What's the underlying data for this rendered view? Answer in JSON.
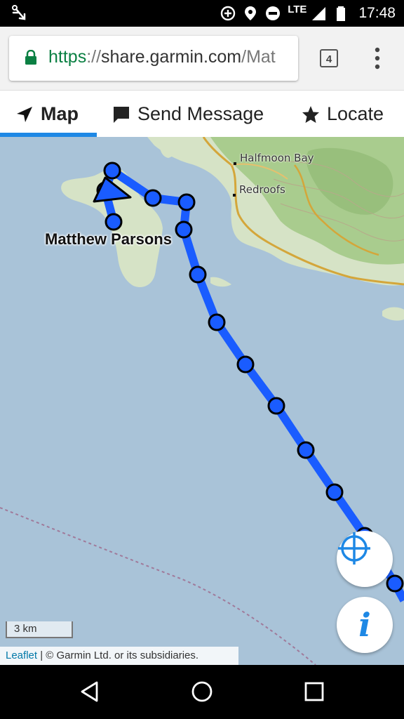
{
  "status_bar": {
    "left_icon": "anchor-icon",
    "icons": [
      "data-saver-icon",
      "location-pin-icon",
      "do-not-disturb-icon",
      "signal-icon",
      "battery-icon"
    ],
    "network": "LTE",
    "time": "17:48"
  },
  "browser": {
    "url_scheme": "https",
    "url_sep": "://",
    "url_host": "share.garmin.com",
    "url_path": "/Mat",
    "tab_count": "4",
    "menu_icon": "more-vert-icon"
  },
  "tabs": [
    {
      "label": "Map",
      "icon": "navigation-arrow-icon",
      "active": true
    },
    {
      "label": "Send Message",
      "icon": "chat-bubble-icon",
      "active": false
    },
    {
      "label": "Locate",
      "icon": "star-icon",
      "active": false
    }
  ],
  "map": {
    "places": [
      "Halfmoon Bay",
      "Redroofs"
    ],
    "tracked_name": "Matthew Parsons",
    "scale_label": "3 km",
    "attribution_link": "Leaflet",
    "attribution_text": " | © Garmin Ltd. or its subsidiaries.",
    "colors": {
      "water": "#a9c3d8",
      "land": "#d6e3c6",
      "forest": "#a9cc8e",
      "track": "#1a5cff",
      "road": "#d4a63a",
      "accent": "#1e88e5"
    }
  },
  "controls": {
    "locate_icon": "crosshair-icon",
    "info_label": "i"
  },
  "nav": {
    "icons": [
      "back-icon",
      "home-icon",
      "recents-icon"
    ]
  }
}
